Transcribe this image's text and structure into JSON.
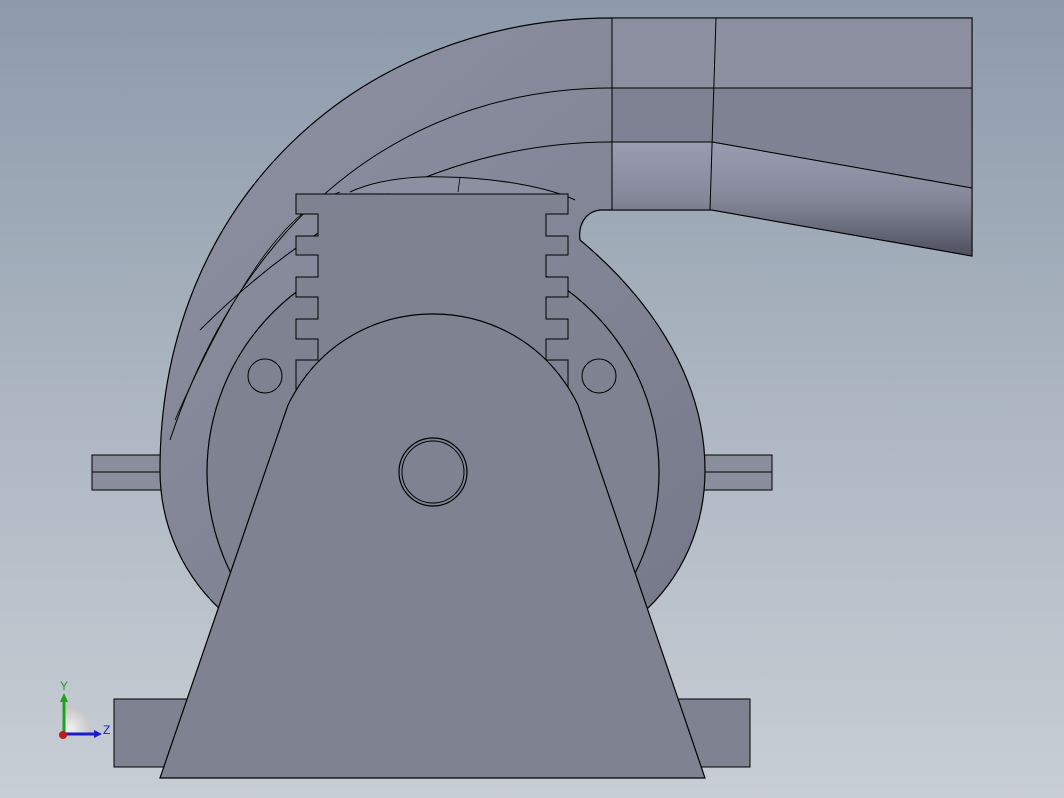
{
  "viewport": {
    "background_top": "#8d9aaa",
    "background_bottom": "#c8ced5"
  },
  "model": {
    "body_color": "#7f8291",
    "edge_color": "#000000"
  },
  "triad": {
    "y_label": "Y",
    "z_label": "Z",
    "y_color": "#1aa51a",
    "z_color": "#1a1ad0",
    "x_color": "#c01a1a"
  }
}
